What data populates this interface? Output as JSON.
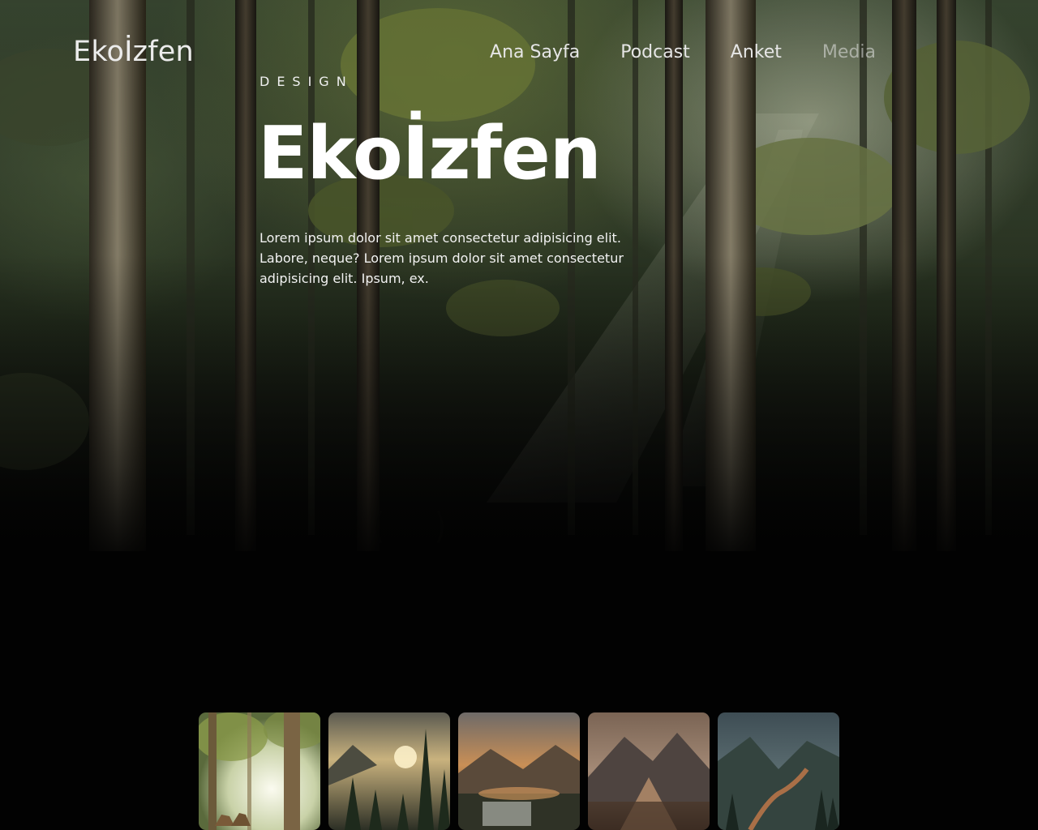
{
  "header": {
    "brand": "Ekoİzfen",
    "nav": [
      {
        "label": "Ana Sayfa"
      },
      {
        "label": "Podcast"
      },
      {
        "label": "Anket"
      },
      {
        "label": "Media"
      }
    ]
  },
  "hero": {
    "eyebrow": "DESIGN",
    "title": "Ekoİzfen",
    "description": "Lorem ipsum dolor sit amet consectetur adipisicing elit. Labore, neque? Lorem ipsum dolor sit amet consectetur adipisicing elit. Ipsum, ex."
  },
  "gallery": {
    "items": [
      {
        "icon": "forest-deer-image"
      },
      {
        "icon": "misty-pine-sunset-image"
      },
      {
        "icon": "mountain-waterfall-image"
      },
      {
        "icon": "mountain-valley-image"
      },
      {
        "icon": "river-valley-image"
      }
    ]
  },
  "colors": {
    "background": "#020202",
    "text": "#ffffff",
    "forest_green": "#34402c"
  }
}
